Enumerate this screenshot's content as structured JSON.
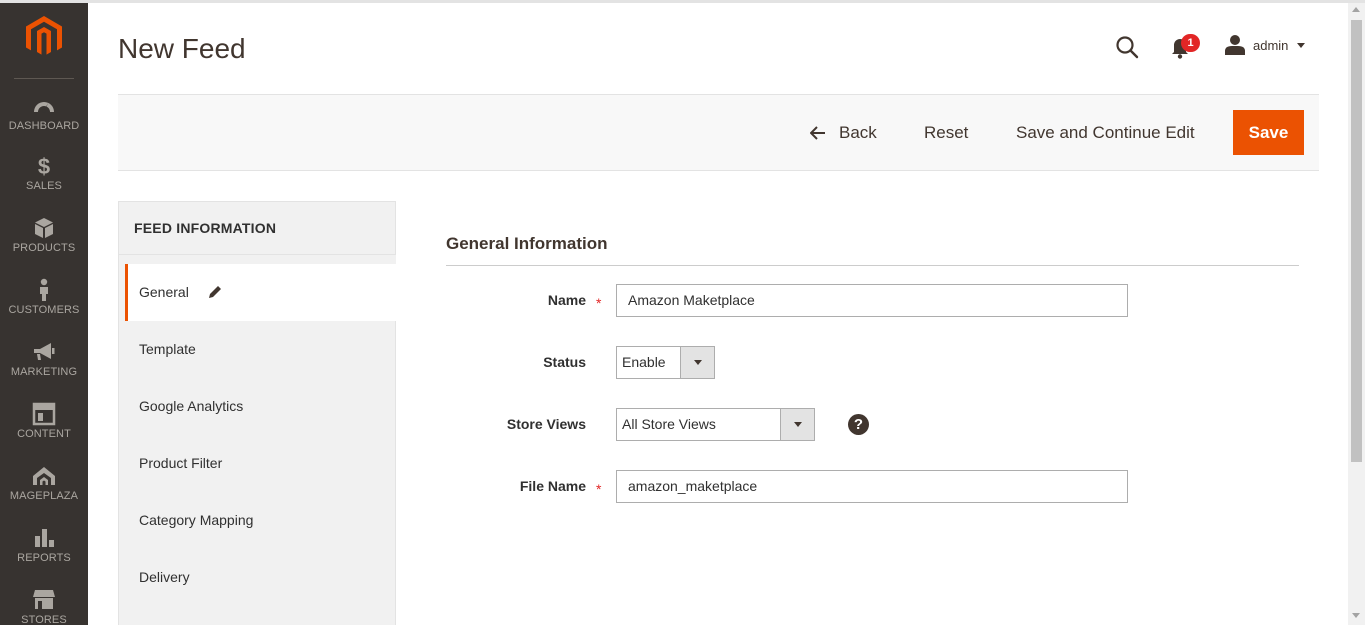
{
  "sidebar": {
    "items": [
      {
        "label": "DASHBOARD",
        "icon": "dashboard-icon"
      },
      {
        "label": "SALES",
        "icon": "dollar-icon"
      },
      {
        "label": "PRODUCTS",
        "icon": "box-icon"
      },
      {
        "label": "CUSTOMERS",
        "icon": "person-icon"
      },
      {
        "label": "MARKETING",
        "icon": "megaphone-icon"
      },
      {
        "label": "CONTENT",
        "icon": "layout-icon"
      },
      {
        "label": "MAGEPLAZA",
        "icon": "mageplaza-icon"
      },
      {
        "label": "REPORTS",
        "icon": "bar-chart-icon"
      },
      {
        "label": "STORES",
        "icon": "store-icon"
      }
    ]
  },
  "header": {
    "title": "New Feed",
    "notification_count": "1",
    "user_name": "admin"
  },
  "actions": {
    "back": "Back",
    "reset": "Reset",
    "save_continue": "Save and Continue Edit",
    "save": "Save"
  },
  "tabs": {
    "heading": "FEED INFORMATION",
    "items": [
      {
        "label": "General",
        "active": true
      },
      {
        "label": "Template"
      },
      {
        "label": "Google Analytics"
      },
      {
        "label": "Product Filter"
      },
      {
        "label": "Category Mapping"
      },
      {
        "label": "Delivery"
      }
    ]
  },
  "form": {
    "section_title": "General Information",
    "name": {
      "label": "Name",
      "value": "Amazon Maketplace",
      "required": true
    },
    "status": {
      "label": "Status",
      "value": "Enable"
    },
    "store_views": {
      "label": "Store Views",
      "value": "All Store Views"
    },
    "file_name": {
      "label": "File Name",
      "value": "amazon_maketplace",
      "required": true
    },
    "required_mark": "*",
    "help_mark": "?"
  },
  "colors": {
    "sidebar_bg": "#373330",
    "accent": "#eb5202",
    "badge": "#e22626"
  }
}
